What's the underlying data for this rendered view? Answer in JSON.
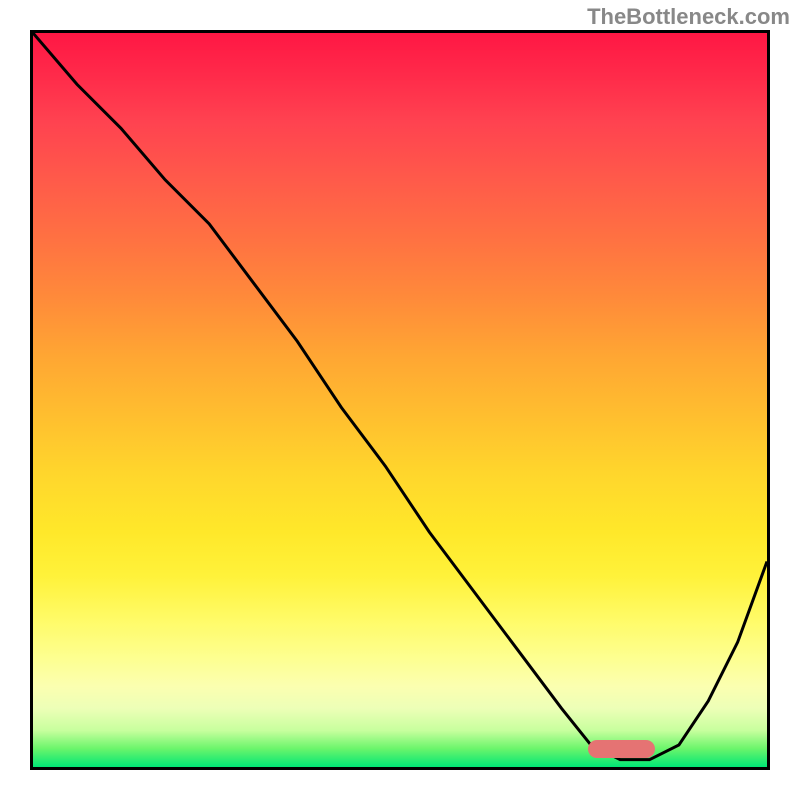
{
  "watermark": "TheBottleneck.com",
  "colors": {
    "border": "#000000",
    "curve": "#000000",
    "marker": "#e57373",
    "gradient_top": "#ff1744",
    "gradient_mid_orange": "#ff8a3a",
    "gradient_mid_yellow": "#fff23a",
    "gradient_bottom": "#00e676"
  },
  "chart_data": {
    "type": "line",
    "title": "",
    "xlabel": "",
    "ylabel": "",
    "xlim": [
      0,
      100
    ],
    "ylim": [
      0,
      100
    ],
    "grid": false,
    "legend_position": "none",
    "series": [
      {
        "name": "bottleneck-curve",
        "x": [
          0,
          6,
          12,
          18,
          24,
          30,
          36,
          42,
          48,
          54,
          60,
          66,
          72,
          76,
          80,
          84,
          88,
          92,
          96,
          100
        ],
        "y": [
          100,
          93,
          87,
          80,
          74,
          66,
          58,
          49,
          41,
          32,
          24,
          16,
          8,
          3,
          1,
          1,
          3,
          9,
          17,
          28
        ]
      }
    ],
    "annotations": [
      {
        "name": "optimal-range-marker",
        "kind": "bar",
        "x_start": 75,
        "x_end": 84,
        "y": 2,
        "height": 2.5
      }
    ],
    "background_gradient": {
      "direction": "vertical",
      "stops": [
        {
          "pos": 0.0,
          "color": "#ff1744"
        },
        {
          "pos": 0.2,
          "color": "#ff5a4a"
        },
        {
          "pos": 0.4,
          "color": "#ff9a36"
        },
        {
          "pos": 0.6,
          "color": "#ffd62c"
        },
        {
          "pos": 0.8,
          "color": "#fffb68"
        },
        {
          "pos": 0.93,
          "color": "#d6ffa8"
        },
        {
          "pos": 1.0,
          "color": "#00e676"
        }
      ]
    }
  }
}
